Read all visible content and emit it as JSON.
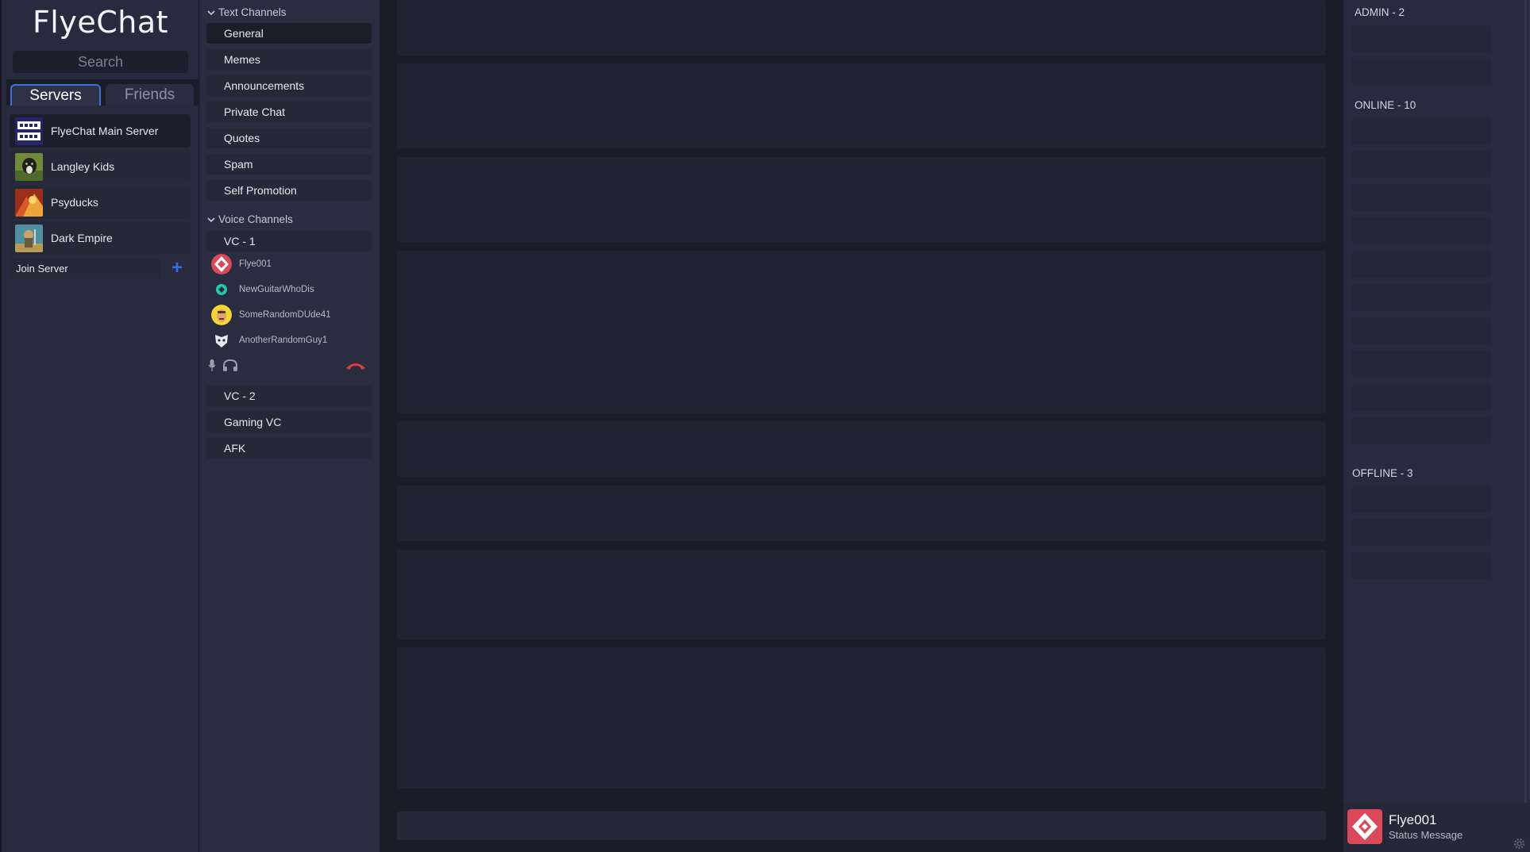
{
  "app": {
    "title": "FlyeChat"
  },
  "search": {
    "placeholder": "Search"
  },
  "tabs": [
    {
      "label": "Servers",
      "active": true
    },
    {
      "label": "Friends",
      "active": false
    }
  ],
  "servers": [
    {
      "name": "FlyeChat Main Server",
      "icon": "flyechat-logo",
      "selected": true
    },
    {
      "name": "Langley Kids",
      "icon": "dog-photo"
    },
    {
      "name": "Psyducks",
      "icon": "psyduck-art"
    },
    {
      "name": "Dark Empire",
      "icon": "knight-art"
    }
  ],
  "join_server": {
    "label": "Join Server",
    "add_icon": "plus-icon"
  },
  "text_channels": {
    "header": "Text Channels",
    "items": [
      "General",
      "Memes",
      "Announcements",
      "Private Chat",
      "Quotes",
      "Spam",
      "Self Promotion"
    ],
    "active": "General"
  },
  "voice_channels": {
    "header": "Voice Channels",
    "vc1": {
      "name": "VC - 1",
      "users": [
        "Flye001",
        "NewGuitarWhoDis",
        "SomeRandomDUde41",
        "AnotherRandomGuy1"
      ]
    },
    "others": [
      "VC - 2",
      "Gaming VC",
      "AFK"
    ]
  },
  "members": {
    "admin_header": "ADMIN - 2",
    "online_header": "ONLINE - 10",
    "offline_header": "OFFLINE - 3"
  },
  "user": {
    "name": "Flye001",
    "status": "Status Message"
  },
  "colors": {
    "accent": "#3d6fe0",
    "hangup": "#e23b3b",
    "add": "#2f6fe8"
  }
}
